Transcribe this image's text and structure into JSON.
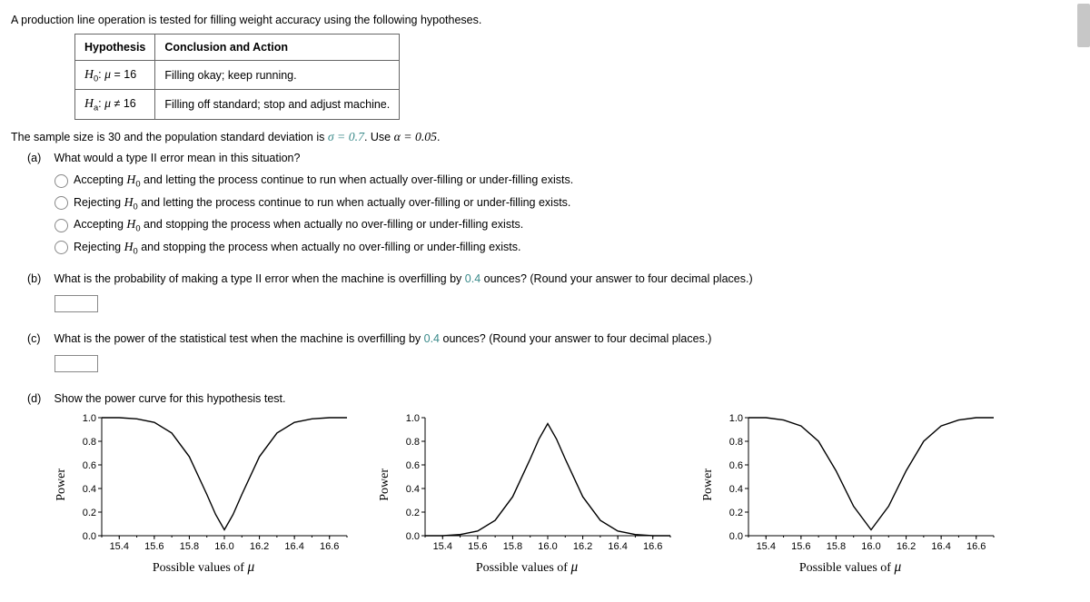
{
  "intro": "A production line operation is tested for filling weight accuracy using the following hypotheses.",
  "table": {
    "head_h": "Hypothesis",
    "head_c": "Conclusion and Action",
    "r1_h": "H₀: μ = 16",
    "r1_c": "Filling okay; keep running.",
    "r2_h": "Hₐ: μ ≠ 16",
    "r2_c": "Filling off standard; stop and adjust machine."
  },
  "given_pre": "The sample size is 30 and the population standard deviation is ",
  "given_sigma": "σ = 0.7",
  "given_mid": ". Use ",
  "given_alpha": "α = 0.05",
  "given_post": ".",
  "a": {
    "label": "(a)",
    "q": "What would a type II error mean in this situation?",
    "opts": [
      "Accepting H₀ and letting the process continue to run when actually over-filling or under-filling exists.",
      "Rejecting H₀ and letting the process continue to run when actually over-filling or under-filling exists.",
      "Accepting H₀ and stopping the process when actually no over-filling or under-filling exists.",
      "Rejecting H₀ and stopping the process when actually no over-filling or under-filling exists."
    ]
  },
  "b": {
    "label": "(b)",
    "q_pre": "What is the probability of making a type II error when the machine is overfilling by ",
    "q_val": "0.4",
    "q_post": " ounces? (Round your answer to four decimal places.)"
  },
  "c": {
    "label": "(c)",
    "q_pre": "What is the power of the statistical test when the machine is overfilling by ",
    "q_val": "0.4",
    "q_post": " ounces? (Round your answer to four decimal places.)"
  },
  "d": {
    "label": "(d)",
    "q": "Show the power curve for this hypothesis test."
  },
  "chart_labels": {
    "ylabel": "Power",
    "xlabel_pre": "Possible values of ",
    "xlabel_mu": "μ",
    "yticks": [
      "1.0",
      "0.8",
      "0.6",
      "0.4",
      "0.2",
      "0.0"
    ],
    "xticks": [
      "15.4",
      "15.6",
      "15.8",
      "16.0",
      "16.2",
      "16.4",
      "16.6"
    ]
  },
  "chart_data": [
    {
      "type": "line",
      "xlabel": "Possible values of μ",
      "ylabel": "Power",
      "xlim": [
        15.3,
        16.7
      ],
      "ylim": [
        0.0,
        1.0
      ],
      "x": [
        15.3,
        15.4,
        15.5,
        15.6,
        15.7,
        15.8,
        15.9,
        15.95,
        16.0,
        16.05,
        16.1,
        16.2,
        16.3,
        16.4,
        16.5,
        16.6,
        16.7
      ],
      "power": [
        1.0,
        1.0,
        0.99,
        0.96,
        0.87,
        0.67,
        0.35,
        0.18,
        0.05,
        0.18,
        0.35,
        0.67,
        0.87,
        0.96,
        0.99,
        1.0,
        1.0
      ]
    },
    {
      "type": "line",
      "xlabel": "Possible values of μ",
      "ylabel": "Power",
      "xlim": [
        15.3,
        16.7
      ],
      "ylim": [
        0.0,
        1.0
      ],
      "x": [
        15.3,
        15.4,
        15.5,
        15.6,
        15.7,
        15.8,
        15.9,
        15.95,
        16.0,
        16.05,
        16.1,
        16.2,
        16.3,
        16.4,
        16.5,
        16.6,
        16.7
      ],
      "power": [
        0.0,
        0.0,
        0.01,
        0.04,
        0.13,
        0.33,
        0.65,
        0.82,
        0.95,
        0.82,
        0.65,
        0.33,
        0.13,
        0.04,
        0.01,
        0.0,
        0.0
      ]
    },
    {
      "type": "line",
      "xlabel": "Possible values of μ",
      "ylabel": "Power",
      "xlim": [
        15.3,
        16.7
      ],
      "ylim": [
        0.0,
        1.0
      ],
      "x": [
        15.3,
        15.4,
        15.5,
        15.6,
        15.7,
        15.8,
        15.9,
        16.0,
        16.1,
        16.2,
        16.3,
        16.4,
        16.5,
        16.6,
        16.7
      ],
      "power": [
        1.0,
        1.0,
        0.98,
        0.93,
        0.8,
        0.55,
        0.25,
        0.05,
        0.25,
        0.55,
        0.8,
        0.93,
        0.98,
        1.0,
        1.0
      ],
      "note": "rendered identical to chart 1 (power curve)"
    }
  ]
}
